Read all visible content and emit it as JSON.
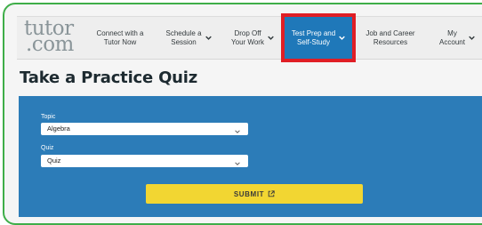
{
  "logo": {
    "line1": "tutor",
    "line2": ".com"
  },
  "nav": {
    "items": [
      {
        "label1": "Connect with a",
        "label2": "Tutor Now",
        "chevron": false
      },
      {
        "label1": "Schedule a",
        "label2": "Session",
        "chevron": true
      },
      {
        "label1": "Drop Off",
        "label2": "Your Work",
        "chevron": true
      },
      {
        "label1": "Test Prep and",
        "label2": "Self-Study",
        "chevron": true,
        "active": true
      },
      {
        "label1": "Job and Career",
        "label2": "Resources",
        "chevron": false
      },
      {
        "label1": "My",
        "label2": "Account",
        "chevron": true
      }
    ]
  },
  "page": {
    "title": "Take a Practice Quiz"
  },
  "form": {
    "topic_label": "Topic",
    "topic_value": "Algebra",
    "quiz_label": "Quiz",
    "quiz_value": "Quiz",
    "submit_label": "SUBMIT"
  },
  "colors": {
    "frame_border": "#3fae49",
    "panel": "#2c7cb8",
    "active_nav": "#1f78b9",
    "highlight": "#e01e25",
    "submit": "#f2d632"
  },
  "icons": [
    "chevron-down-icon",
    "external-link-icon"
  ]
}
